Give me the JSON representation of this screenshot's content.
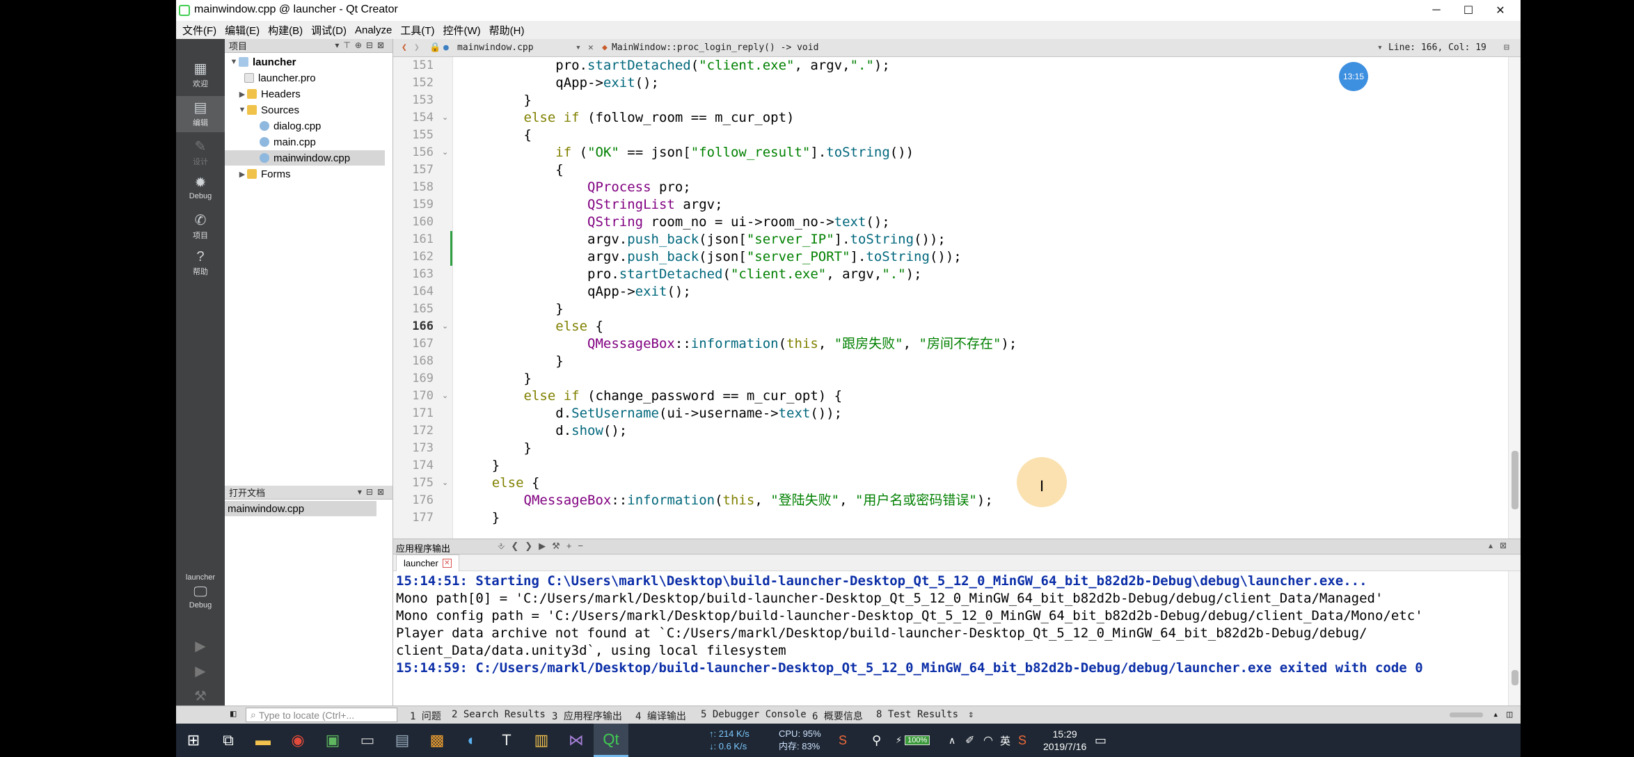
{
  "window": {
    "title": "mainwindow.cpp @ launcher - Qt Creator",
    "controls": {
      "minimize": "─",
      "maximize": "☐",
      "close": "✕"
    }
  },
  "menubar": [
    "文件(F)",
    "编辑(E)",
    "构建(B)",
    "调试(D)",
    "Analyze",
    "工具(T)",
    "控件(W)",
    "帮助(H)"
  ],
  "modes": [
    {
      "label": "欢迎",
      "icon": "grid-icon"
    },
    {
      "label": "编辑",
      "icon": "edit-doc-icon"
    },
    {
      "label": "设计",
      "icon": "pen-icon"
    },
    {
      "label": "Debug",
      "icon": "bug-icon"
    },
    {
      "label": "项目",
      "icon": "wrench-icon"
    },
    {
      "label": "帮助",
      "icon": "help-icon"
    }
  ],
  "kit": {
    "project": "launcher",
    "config": "Debug"
  },
  "project_panel": {
    "header": "项目",
    "tree": [
      {
        "label": "launcher",
        "level": 0,
        "expanded": true
      },
      {
        "label": "launcher.pro",
        "level": 1
      },
      {
        "label": "Headers",
        "level": 1,
        "expanded": false
      },
      {
        "label": "Sources",
        "level": 1,
        "expanded": true
      },
      {
        "label": "dialog.cpp",
        "level": 2
      },
      {
        "label": "main.cpp",
        "level": 2
      },
      {
        "label": "mainwindow.cpp",
        "level": 2,
        "selected": true
      },
      {
        "label": "Forms",
        "level": 1,
        "expanded": false
      }
    ]
  },
  "open_docs": {
    "header": "打开文档",
    "items": [
      "mainwindow.cpp"
    ]
  },
  "editor": {
    "file": "mainwindow.cpp",
    "symbol": "MainWindow::proc_login_reply() -> void",
    "position": "Line: 166, Col: 19",
    "lines": [
      {
        "n": "151",
        "text": "            pro.startDetached(\"client.exe\", argv,\".\");"
      },
      {
        "n": "152",
        "text": "            qApp->exit();"
      },
      {
        "n": "153",
        "text": "        }"
      },
      {
        "n": "154",
        "text": "        else if (follow_room == m_cur_opt)",
        "fold": true
      },
      {
        "n": "155",
        "text": "        {"
      },
      {
        "n": "156",
        "text": "            if (\"OK\" == json[\"follow_result\"].toString())",
        "fold": true
      },
      {
        "n": "157",
        "text": "            {"
      },
      {
        "n": "158",
        "text": "                QProcess pro;"
      },
      {
        "n": "159",
        "text": "                QStringList argv;"
      },
      {
        "n": "160",
        "text": "                QString room_no = ui->room_no->text();"
      },
      {
        "n": "161",
        "text": "                argv.push_back(json[\"server_IP\"].toString());",
        "changed": true
      },
      {
        "n": "162",
        "text": "                argv.push_back(json[\"server_PORT\"].toString());",
        "changed": true
      },
      {
        "n": "163",
        "text": "                pro.startDetached(\"client.exe\", argv,\".\");"
      },
      {
        "n": "164",
        "text": "                qApp->exit();"
      },
      {
        "n": "165",
        "text": "            }"
      },
      {
        "n": "166",
        "text": "            else {",
        "fold": true,
        "current": true
      },
      {
        "n": "167",
        "text": "                QMessageBox::information(this, \"跟房失败\", \"房间不存在\");"
      },
      {
        "n": "168",
        "text": "            }"
      },
      {
        "n": "169",
        "text": "        }"
      },
      {
        "n": "170",
        "text": "        else if (change_password == m_cur_opt) {",
        "fold": true
      },
      {
        "n": "171",
        "text": "            d.SetUsername(ui->username->text());"
      },
      {
        "n": "172",
        "text": "            d.show();"
      },
      {
        "n": "173",
        "text": "        }"
      },
      {
        "n": "174",
        "text": "    }"
      },
      {
        "n": "175",
        "text": "    else {",
        "fold": true
      },
      {
        "n": "176",
        "text": "        QMessageBox::information(this, \"登陆失败\", \"用户名或密码错误\");"
      },
      {
        "n": "177",
        "text": "    }"
      }
    ],
    "timestamp_badge": "13:15"
  },
  "output": {
    "header": "应用程序输出",
    "tab": "launcher",
    "lines": [
      {
        "text": "15:14:51: Starting C:\\Users\\markl\\Desktop\\build-launcher-Desktop_Qt_5_12_0_MinGW_64_bit_b82d2b-Debug\\debug\\launcher.exe...",
        "blue": true
      },
      {
        "text": "Mono path[0] = 'C:/Users/markl/Desktop/build-launcher-Desktop_Qt_5_12_0_MinGW_64_bit_b82d2b-Debug/debug/client_Data/Managed'"
      },
      {
        "text": "Mono config path = 'C:/Users/markl/Desktop/build-launcher-Desktop_Qt_5_12_0_MinGW_64_bit_b82d2b-Debug/debug/client_Data/Mono/etc'"
      },
      {
        "text": "Player data archive not found at `C:/Users/markl/Desktop/build-launcher-Desktop_Qt_5_12_0_MinGW_64_bit_b82d2b-Debug/debug/"
      },
      {
        "text": "client_Data/data.unity3d`, using local filesystem"
      },
      {
        "text": "15:14:59: C:/Users/markl/Desktop/build-launcher-Desktop_Qt_5_12_0_MinGW_64_bit_b82d2b-Debug/debug/launcher.exe exited with code 0",
        "blue": true
      }
    ]
  },
  "statusbar": {
    "locate_placeholder": "Type to locate (Ctrl+...",
    "panes": [
      "1 问题",
      "2 Search Results",
      "3 应用程序输出",
      "4 编译输出",
      "5 Debugger Console",
      "6 概要信息",
      "8 Test Results"
    ]
  },
  "taskbar": {
    "net_up": "↑: 214 K/s",
    "net_down": "↓: 0.6 K/s",
    "cpu": "CPU: 95%",
    "mem": "内存: 83%",
    "battery": "100%",
    "ime": "英",
    "time": "15:29",
    "date": "2019/7/16"
  }
}
